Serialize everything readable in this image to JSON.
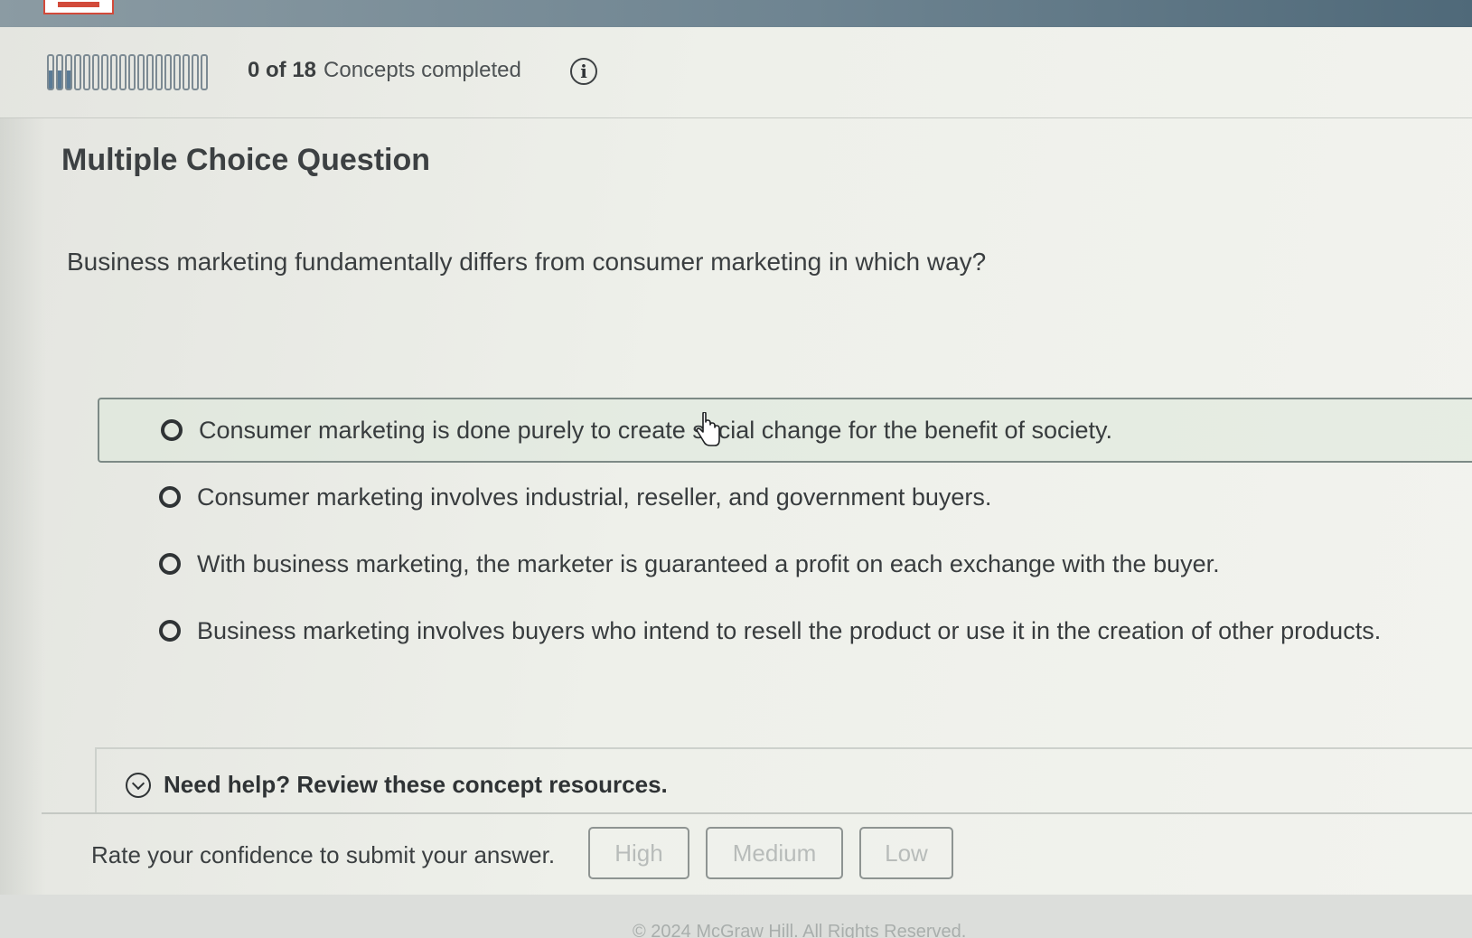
{
  "header": {
    "progress": {
      "completed": 0,
      "total": 18,
      "count_text": "0 of 18",
      "label": "Concepts completed",
      "segments": 18,
      "partial_segments": 3
    },
    "info_icon": "i"
  },
  "question": {
    "title": "Multiple Choice Question",
    "prompt": "Business marketing fundamentally differs from consumer marketing in which way?",
    "options": [
      {
        "label": "Consumer marketing is done purely to create social change for the benefit of society."
      },
      {
        "label": "Consumer marketing involves industrial, reseller, and government buyers."
      },
      {
        "label": "With business marketing, the marketer is guaranteed a profit on each exchange with the buyer."
      },
      {
        "label": "Business marketing involves buyers who intend to resell the product or use it in the creation of other products."
      }
    ]
  },
  "help": {
    "toggle_label": "Need help? Review these concept resources."
  },
  "confidence": {
    "label": "Rate your confidence to submit your answer.",
    "buttons": [
      "High",
      "Medium",
      "Low"
    ]
  },
  "footer": {
    "copyright": "© 2024 McGraw Hill. All Rights Reserved."
  },
  "colors": {
    "topbar": "#6e8491",
    "progress_fill": "#5a7b96",
    "hover_option_bg": "#dce8da",
    "disabled_button_text": "#b8bcba"
  }
}
